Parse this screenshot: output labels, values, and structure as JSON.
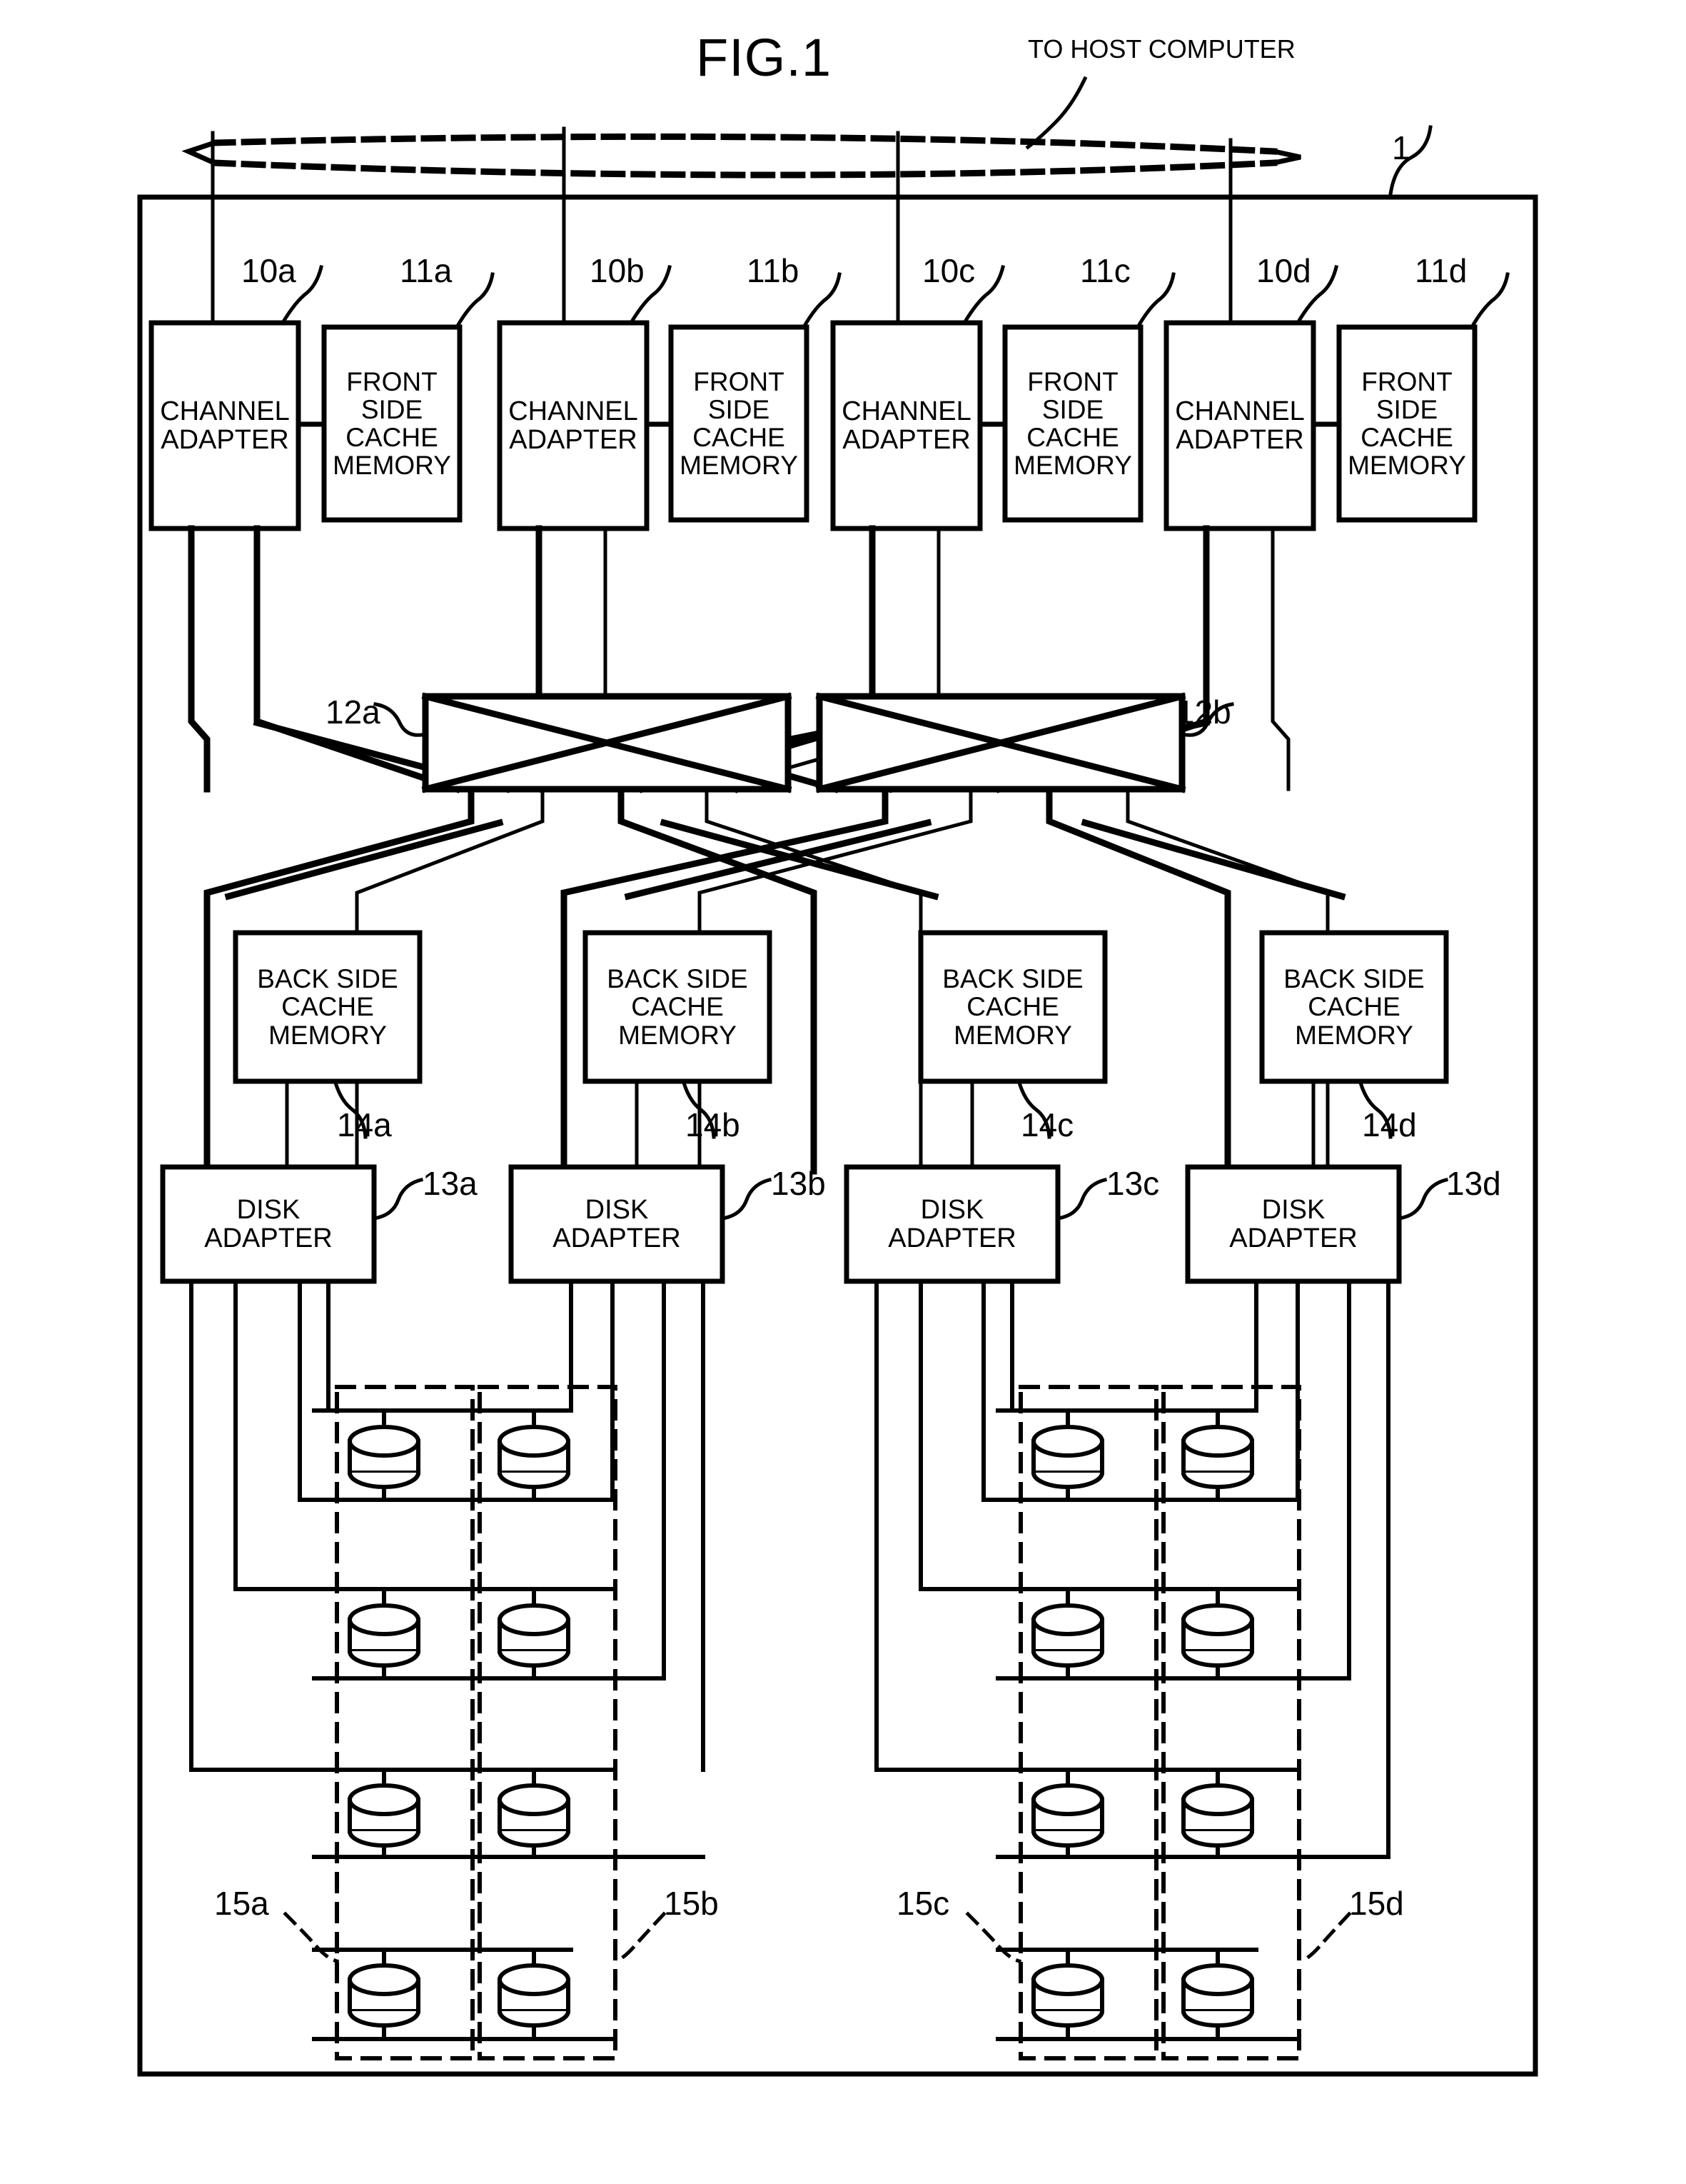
{
  "figure": {
    "title": "FIG.1",
    "host_label": "TO HOST COMPUTER",
    "system_ref": "1"
  },
  "channel_adapters": [
    {
      "label": "CHANNEL\nADAPTER",
      "ref": "10a"
    },
    {
      "label": "CHANNEL\nADAPTER",
      "ref": "10b"
    },
    {
      "label": "CHANNEL\nADAPTER",
      "ref": "10c"
    },
    {
      "label": "CHANNEL\nADAPTER",
      "ref": "10d"
    }
  ],
  "front_side_cache_memories": [
    {
      "label": "FRONT\nSIDE\nCACHE\nMEMORY",
      "ref": "11a"
    },
    {
      "label": "FRONT\nSIDE\nCACHE\nMEMORY",
      "ref": "11b"
    },
    {
      "label": "FRONT\nSIDE\nCACHE\nMEMORY",
      "ref": "11c"
    },
    {
      "label": "FRONT\nSIDE\nCACHE\nMEMORY",
      "ref": "11d"
    }
  ],
  "switches": [
    {
      "ref": "12a"
    },
    {
      "ref": "12b"
    }
  ],
  "back_side_cache_memories": [
    {
      "label": "BACK SIDE\nCACHE\nMEMORY",
      "ref": "14a"
    },
    {
      "label": "BACK SIDE\nCACHE\nMEMORY",
      "ref": "14b"
    },
    {
      "label": "BACK SIDE\nCACHE\nMEMORY",
      "ref": "14c"
    },
    {
      "label": "BACK SIDE\nCACHE\nMEMORY",
      "ref": "14d"
    }
  ],
  "disk_adapters": [
    {
      "label": "DISK\nADAPTER",
      "ref": "13a"
    },
    {
      "label": "DISK\nADAPTER",
      "ref": "13b"
    },
    {
      "label": "DISK\nADAPTER",
      "ref": "13c"
    },
    {
      "label": "DISK\nADAPTER",
      "ref": "13d"
    }
  ],
  "disk_groups": [
    {
      "ref": "15a",
      "disk_count": 4
    },
    {
      "ref": "15b",
      "disk_count": 4
    },
    {
      "ref": "15c",
      "disk_count": 4
    },
    {
      "ref": "15d",
      "disk_count": 4
    }
  ],
  "colors": {
    "line": "#000000",
    "background": "#ffffff"
  }
}
